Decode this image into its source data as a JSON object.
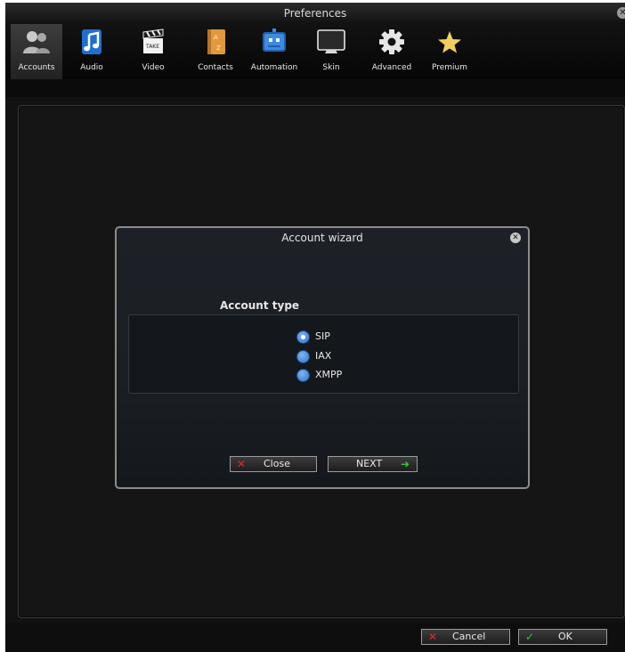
{
  "window": {
    "title": "Preferences",
    "close_glyph": "✕"
  },
  "toolbar": {
    "items": [
      {
        "label": "Accounts",
        "icon": "users-icon",
        "active": true
      },
      {
        "label": "Audio",
        "icon": "music-note-icon"
      },
      {
        "label": "Video",
        "icon": "clapperboard-icon"
      },
      {
        "label": "Contacts",
        "icon": "address-book-icon"
      },
      {
        "label": "Automation",
        "icon": "robot-icon"
      },
      {
        "label": "Skin",
        "icon": "monitor-icon"
      },
      {
        "label": "Advanced",
        "icon": "gear-icon"
      },
      {
        "label": "Premium",
        "icon": "star-icon"
      }
    ]
  },
  "wizard": {
    "title": "Account wizard",
    "close_glyph": "✕",
    "section_label": "Account type",
    "options": [
      {
        "label": "SIP",
        "checked": true
      },
      {
        "label": "IAX",
        "checked": false
      },
      {
        "label": "XMPP",
        "checked": false
      }
    ],
    "close_button": {
      "label": "Close",
      "glyph": "✕"
    },
    "next_button": {
      "label": "NEXT",
      "glyph": "➜"
    }
  },
  "footer": {
    "cancel_button": {
      "label": "Cancel",
      "glyph": "✕"
    },
    "ok_button": {
      "label": "OK",
      "glyph": "✓"
    }
  },
  "colors": {
    "accent_blue": "#2d72c9",
    "cancel_red": "#e02b2b",
    "ok_green": "#3fbf3f"
  }
}
